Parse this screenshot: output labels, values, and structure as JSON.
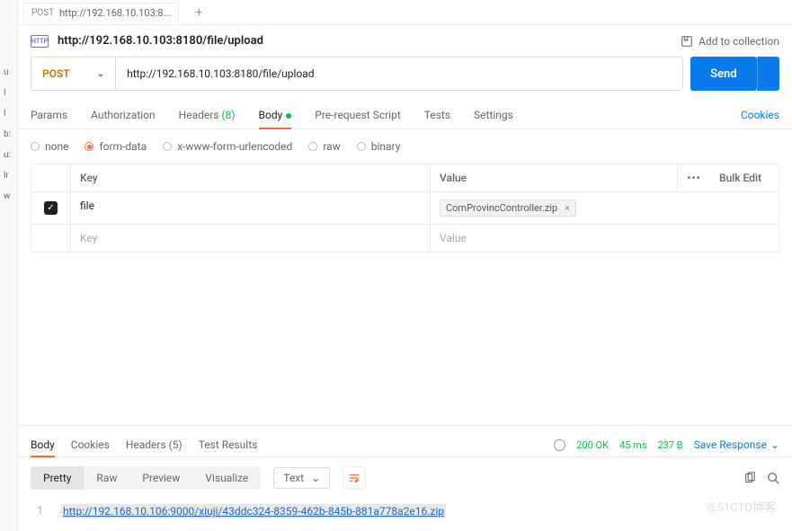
{
  "sidebar_icons": [
    "u",
    "l",
    "l",
    "b:",
    "u:",
    "lr",
    "w"
  ],
  "tab": {
    "method": "POST",
    "title": "http://192.168.10.103:8..."
  },
  "header": {
    "url": "http://192.168.10.103:8180/file/upload",
    "add_to_collection": "Add to collection"
  },
  "request": {
    "method": "POST",
    "url": "http://192.168.10.103:8180/file/upload",
    "send": "Send"
  },
  "tabs": {
    "params": "Params",
    "auth": "Authorization",
    "headers": "Headers",
    "headers_count": "(8)",
    "body": "Body",
    "prerequest": "Pre-request Script",
    "tests": "Tests",
    "settings": "Settings",
    "cookies": "Cookies"
  },
  "body_types": {
    "none": "none",
    "form": "form-data",
    "xwww": "x-www-form-urlencoded",
    "raw": "raw",
    "binary": "binary"
  },
  "kv": {
    "key_header": "Key",
    "value_header": "Value",
    "bulk": "Bulk Edit",
    "row1_key": "file",
    "row1_value": "ComProvincController.zip",
    "placeholder_key": "Key",
    "placeholder_value": "Value"
  },
  "resp_tabs": {
    "body": "Body",
    "cookies": "Cookies",
    "headers": "Headers",
    "headers_count": "(5)",
    "tests": "Test Results"
  },
  "status": {
    "code": "200 OK",
    "time": "45 ms",
    "size": "237 B",
    "save": "Save Response"
  },
  "views": {
    "pretty": "Pretty",
    "raw": "Raw",
    "preview": "Preview",
    "visualize": "Visualize",
    "format": "Text"
  },
  "response_body": "http://192.168.10.106:9000/xiuji/43ddc324-8359-462b-845b-881a778a2e16.zip",
  "watermark": "@51CTO博客"
}
